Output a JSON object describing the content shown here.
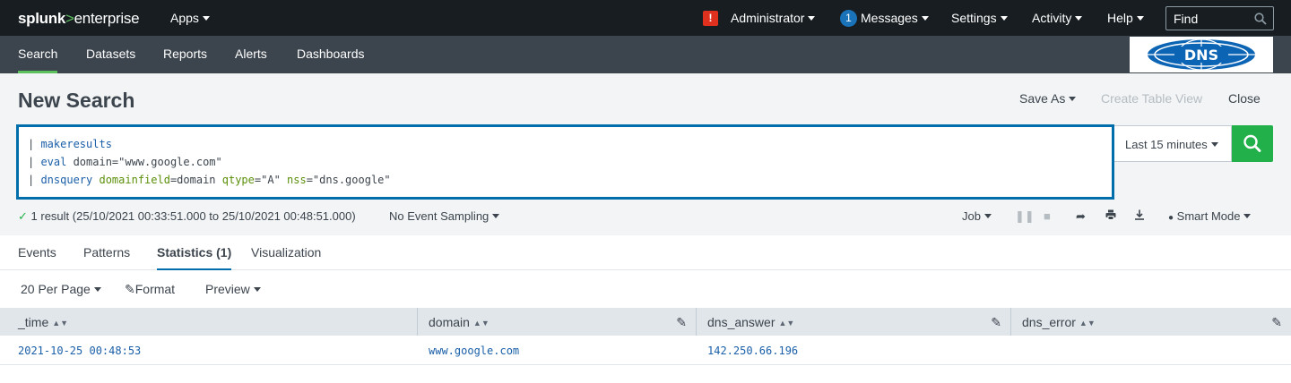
{
  "topbar": {
    "logo_part1": "splunk",
    "logo_gt": ">",
    "logo_part2": "enterprise",
    "apps_label": "Apps",
    "alert_icon": "!",
    "user_label": "Administrator",
    "messages_count": "1",
    "messages_label": "Messages",
    "settings_label": "Settings",
    "activity_label": "Activity",
    "help_label": "Help",
    "find_placeholder": "Find"
  },
  "appnav": {
    "items": [
      "Search",
      "Datasets",
      "Reports",
      "Alerts",
      "Dashboards"
    ],
    "active_index": 0,
    "logo_text": "DNS"
  },
  "header": {
    "title": "New Search",
    "save_as_label": "Save As",
    "create_table_view_label": "Create Table View",
    "close_label": "Close"
  },
  "search": {
    "lines": [
      {
        "pipe": "| ",
        "cmd": "makeresults",
        "rest": ""
      },
      {
        "pipe": "| ",
        "cmd": "eval",
        "rest": " domain=\"www.google.com\""
      },
      {
        "pipe": "| ",
        "cmd": "dnsquery",
        "arg1": " domainfield",
        "val1": "=domain",
        "arg2": " qtype",
        "val2": "=\"A\"",
        "arg3": " nss",
        "val3": "=\"dns.google\""
      }
    ],
    "time_range": "Last 15 minutes"
  },
  "status": {
    "result_text": "1 result (25/10/2021 00:33:51.000 to 25/10/2021 00:48:51.000)",
    "sampling_label": "No Event Sampling",
    "job_label": "Job",
    "mode_label": "Smart Mode"
  },
  "tabs": {
    "items": [
      "Events",
      "Patterns",
      "Statistics (1)",
      "Visualization"
    ],
    "active_index": 2
  },
  "table_controls": {
    "per_page_label": "20 Per Page",
    "format_label": "Format",
    "preview_label": "Preview"
  },
  "table": {
    "columns": [
      "_time",
      "domain",
      "dns_answer",
      "dns_error"
    ],
    "rows": [
      [
        "2021-10-25 00:48:53",
        "www.google.com",
        "142.250.66.196",
        ""
      ]
    ]
  },
  "colors": {
    "topbar_bg": "#171d21",
    "appnav_bg": "#3c444d",
    "accent_green": "#5cc05c",
    "search_button": "#22b04a",
    "search_border": "#006eaa",
    "link_blue": "#1a5fa8"
  }
}
